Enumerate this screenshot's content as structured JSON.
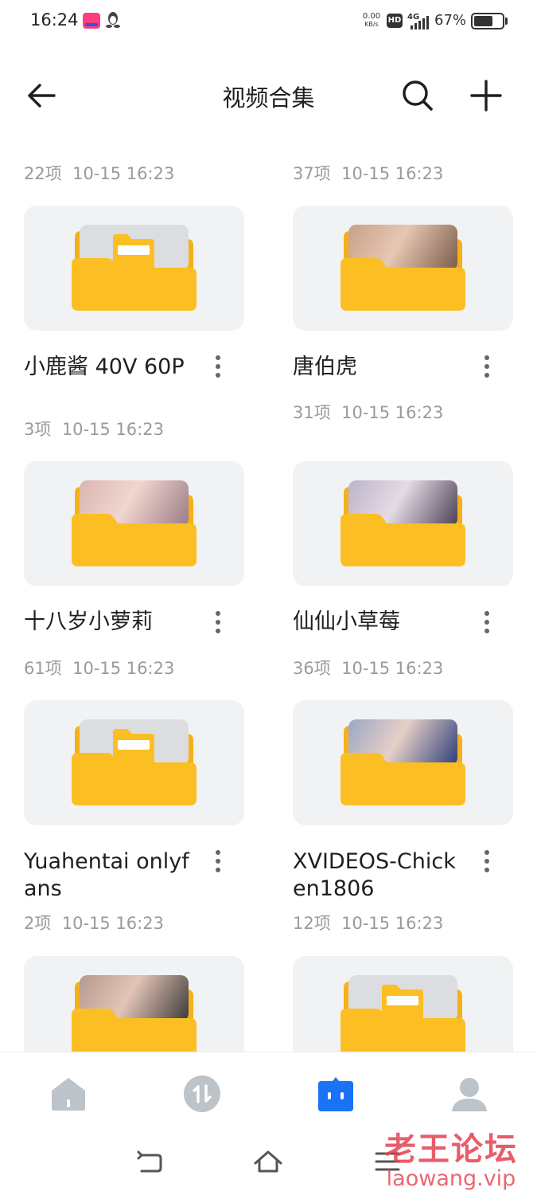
{
  "status_bar": {
    "time": "16:24",
    "net_speed_value": "0.00",
    "net_speed_unit": "KB/s",
    "hd_label": "HD",
    "network_type": "4G",
    "battery_percent": "67%",
    "battery_level": 0.67
  },
  "header": {
    "title": "视频合集",
    "back_icon": "arrow-left-icon",
    "search_icon": "search-icon",
    "add_icon": "plus-icon"
  },
  "top_meta": [
    {
      "count": "22项",
      "date": "10-15 16:23"
    },
    {
      "count": "37项",
      "date": "10-15 16:23"
    }
  ],
  "folders": [
    {
      "name": "小鹿酱 40V 60P",
      "count": "3项",
      "date": "10-15 16:23",
      "has_preview": false
    },
    {
      "name": "唐伯虎",
      "count": "31项",
      "date": "10-15 16:23",
      "has_preview": true
    },
    {
      "name": "十八岁小萝莉",
      "count": "61项",
      "date": "10-15 16:23",
      "has_preview": true
    },
    {
      "name": "仙仙小草莓",
      "count": "36项",
      "date": "10-15 16:23",
      "has_preview": true
    },
    {
      "name": "Yuahentai onlyfans",
      "count": "2项",
      "date": "10-15 16:23",
      "has_preview": false
    },
    {
      "name": "XVIDEOS-Chicken1806",
      "count": "12项",
      "date": "10-15 16:23",
      "has_preview": true
    },
    {
      "name": "",
      "count": "",
      "date": "",
      "has_preview": true
    },
    {
      "name": "",
      "count": "",
      "date": "",
      "has_preview": false
    }
  ],
  "bottom_nav": {
    "items": [
      {
        "icon": "home-icon",
        "active": false
      },
      {
        "icon": "transfer-icon",
        "active": false
      },
      {
        "icon": "files-icon",
        "active": true
      },
      {
        "icon": "profile-icon",
        "active": false
      }
    ]
  },
  "colors": {
    "folder": "#fbbf24",
    "folder_shade": "#f5b01a",
    "accent": "#1a73f5",
    "nav_inactive": "#bcc3c9"
  },
  "watermark": {
    "cn": "老王论坛",
    "en": "laowang.vip"
  }
}
